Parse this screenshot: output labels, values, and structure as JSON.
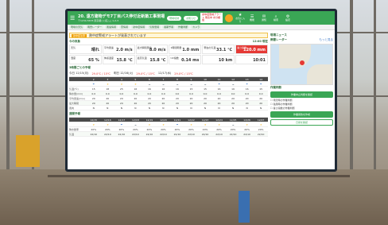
{
  "header": {
    "title": "20. 遠方建物デモ7丁目パス停付近新築工事現場",
    "subtitle": "〒1234-5678 東京都○○区△△ 1-2-3",
    "pill1": "現場切替",
    "pill2": "お知らせ",
    "alert": "熱中症警戒アラート 発表中 水分補給",
    "icons": [
      {
        "glyph": "★",
        "label": "お気に入り"
      },
      {
        "glyph": "☰",
        "label": "機能"
      },
      {
        "glyph": "✉",
        "label": "通知"
      },
      {
        "glyph": "⌕",
        "label": "検索"
      },
      {
        "glyph": "⚙",
        "label": "設定"
      }
    ]
  },
  "tabs": [
    "現場の天気",
    "雨雲レーダー",
    "風速情報",
    "雷情報",
    "熱中症情報",
    "気象警報",
    "長期予報",
    "作業判断",
    "カメラ"
  ],
  "warning": {
    "tag": "熱中症注意",
    "text": "熱中症警戒アラートが発表されています"
  },
  "current": {
    "title": "今の気象",
    "time": "12:00 現在",
    "cells": [
      {
        "label": "天気",
        "value": "晴れ"
      },
      {
        "label": "平均風速",
        "value": "2.0 m/s"
      },
      {
        "label": "最大瞬間風速",
        "value": "8.0 m/s"
      },
      {
        "label": "1時間雨量",
        "value": "1.0 mm"
      },
      {
        "label": "現在の気温",
        "value": "33.1 ℃"
      },
      {
        "label": "暑さ指数",
        "value": "120.0 mm",
        "alert": true
      }
    ],
    "cells2": [
      {
        "label": "湿度",
        "value": "65 %"
      },
      {
        "label": "体感温度",
        "value": "15.8 ℃"
      },
      {
        "label": "最高気温",
        "value": "15.8 ℃"
      },
      {
        "label": "UV指数",
        "value": "0.14 ms"
      },
      {
        "label": "",
        "value": "10 km"
      },
      {
        "label": "",
        "value": "10:01"
      }
    ]
  },
  "hourly": {
    "title": "3時間ごとの予報",
    "nav": "今日 12/15(月)",
    "hl": "29.0℃ / 15℃",
    "next": "明日 12/16(火)",
    "next_hl": "29.0℃ / 15℃",
    "last": "12/17(水)",
    "last_hl": "29.0℃ / 15℃",
    "hours": [
      "2",
      "3",
      "4",
      "5",
      "6",
      "7",
      "8",
      "9",
      "10",
      "11",
      "12",
      "13",
      "14"
    ],
    "weather": [
      "rain",
      "sun",
      "sun",
      "sun",
      "cloud",
      "cloud",
      "cloud",
      "cloud",
      "cloud",
      "rain",
      "cloud",
      "rain",
      "rain"
    ],
    "rows": [
      {
        "label": "気温(℃)",
        "values": [
          "15",
          "18",
          "25",
          "16",
          "16",
          "16",
          "16",
          "15",
          "15",
          "16",
          "16",
          "16",
          "15"
        ]
      },
      {
        "label": "降水量(mm)",
        "values": [
          "0.0",
          "0.0",
          "0.0",
          "0.0",
          "0.0",
          "0.0",
          "0.0",
          "0.0",
          "0.0",
          "0.0",
          "0.0",
          "0.0",
          "0.0"
        ]
      },
      {
        "label": "平均風速(m/s)",
        "values": [
          "20",
          "20",
          "20",
          "20",
          "20",
          "20",
          "20",
          "20",
          "20",
          "20",
          "20",
          "20",
          "20"
        ]
      },
      {
        "label": "最大瞬間",
        "values": [
          "20",
          "20",
          "20",
          "20",
          "20",
          "20",
          "20",
          "20",
          "20",
          "20",
          "20",
          "20",
          "20"
        ]
      },
      {
        "label": "風向",
        "values": [
          "N",
          "N",
          "N",
          "N",
          "N",
          "N",
          "N",
          "N",
          "N",
          "N",
          "N",
          "N",
          "N"
        ]
      }
    ]
  },
  "weekly": {
    "title": "週間予報",
    "days": [
      "12/15",
      "12/16",
      "12/17",
      "12/18",
      "12/19",
      "12/20",
      "12/21",
      "12/22",
      "12/23",
      "12/24",
      "12/25",
      "12/26",
      "12/27"
    ],
    "weather": [
      "sun",
      "sun",
      "rain",
      "cloud",
      "sun",
      "sun",
      "rain",
      "sun",
      "sun",
      "sun",
      "cloud",
      "sun",
      "sun"
    ],
    "rows": [
      {
        "label": "降水確率",
        "values": [
          "20%",
          "20%",
          "20%",
          "20%",
          "20%",
          "20%",
          "20%",
          "20%",
          "20%",
          "20%",
          "20%",
          "20%",
          "20%"
        ]
      },
      {
        "label": "気温",
        "values": [
          "22/10",
          "22/10",
          "22/10",
          "22/10",
          "22/10",
          "22/10",
          "22/10",
          "22/10",
          "22/10",
          "22/10",
          "22/10",
          "22/10",
          "22/10"
        ]
      }
    ]
  },
  "right": {
    "news_title": "現場ニュース",
    "radar_title": "雨雲レーダー",
    "radar_link": "もっと見る",
    "judge_title": "作業判断",
    "judge_btn": "作業中止判断を確認",
    "opt1": "雨天時の作業判断",
    "opt2": "強風時の作業判断",
    "opt3": "暑さ指数の作業判断",
    "btn1": "作業報告を作成",
    "btn2": "日報を確認"
  }
}
